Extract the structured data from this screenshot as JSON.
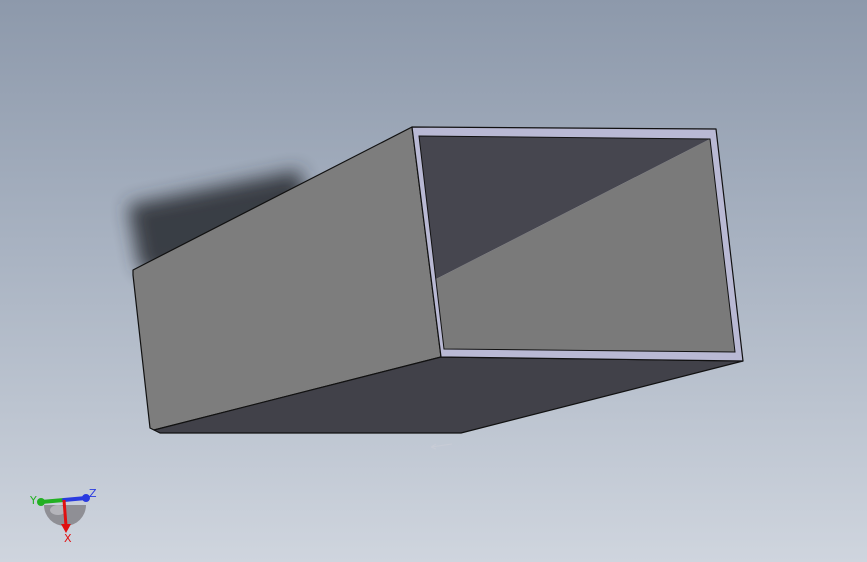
{
  "viewport": {
    "background_top": "#8d99ab",
    "background_bottom": "#cfd5de"
  },
  "model": {
    "name": "rectangular-hollow-tube",
    "face_colors": {
      "side_face": "#7d7d7d",
      "bottom_face": "#414149",
      "inner_dark": "#46464f",
      "inner_light": "#7a7a7a",
      "wall_edge": "#b9b9d4",
      "shadow": "#2e3237"
    }
  },
  "triad": {
    "x_label": "X",
    "y_label": "Y",
    "z_label": "Z",
    "x_color": "#e01010",
    "y_color": "#22b022",
    "z_color": "#2a3be0"
  }
}
